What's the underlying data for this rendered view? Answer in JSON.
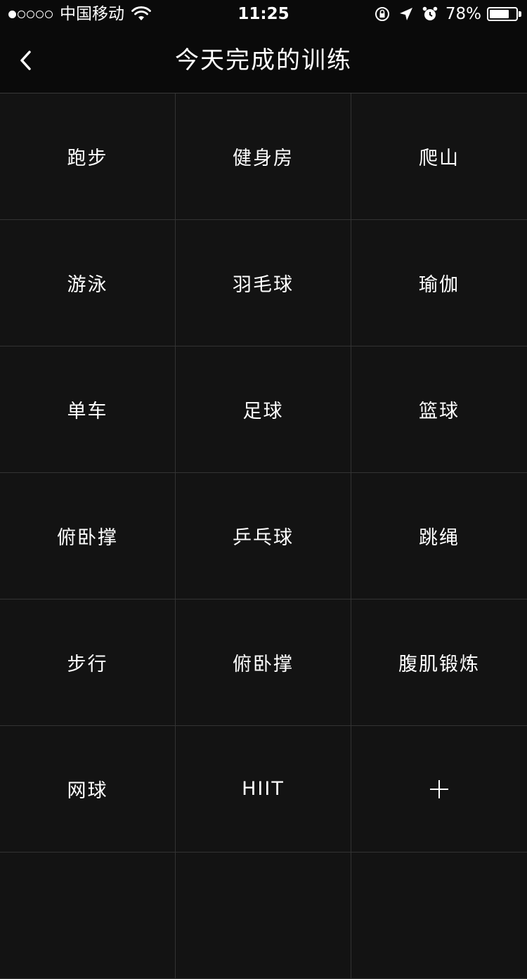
{
  "status_bar": {
    "carrier": "中国移动",
    "time": "11:25",
    "battery_percent": "78%",
    "battery_level": 0.78,
    "signal_bars_filled": 1,
    "signal_bars_total": 5
  },
  "nav": {
    "title": "今天完成的训练",
    "back_icon": "chevron-left-icon"
  },
  "activities": [
    "跑步",
    "健身房",
    "爬山",
    "游泳",
    "羽毛球",
    "瑜伽",
    "单车",
    "足球",
    "篮球",
    "俯卧撑",
    "乒乓球",
    "跳绳",
    "步行",
    "俯卧撑",
    "腹肌锻炼",
    "网球",
    "HIIT"
  ],
  "add_button": {
    "icon": "plus-icon"
  },
  "colors": {
    "background": "#131313",
    "bar": "#0a0a0a",
    "divider": "#333333",
    "text": "#ffffff"
  }
}
